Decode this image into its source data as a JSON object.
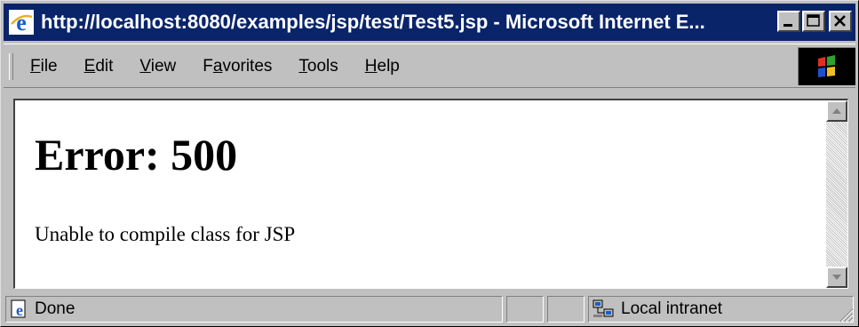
{
  "window": {
    "title": "http://localhost:8080/examples/jsp/test/Test5.jsp - Microsoft Internet E...",
    "icon": "ie-logo-icon",
    "controls": [
      "minimize-icon",
      "maximize-icon",
      "close-icon"
    ]
  },
  "menubar": {
    "items": [
      {
        "label": "File",
        "accel": "F"
      },
      {
        "label": "Edit",
        "accel": "E"
      },
      {
        "label": "View",
        "accel": "V"
      },
      {
        "label": "Favorites",
        "accel": "a"
      },
      {
        "label": "Tools",
        "accel": "T"
      },
      {
        "label": "Help",
        "accel": "H"
      }
    ],
    "throbber_icon": "windows-flag-icon"
  },
  "page": {
    "heading": "Error: 500",
    "message": "Unable to compile class for JSP"
  },
  "statusbar": {
    "status": "Done",
    "status_icon": "ie-page-icon",
    "zone": "Local intranet",
    "zone_icon": "network-computers-icon"
  },
  "colors": {
    "titlebar": "#0a246a",
    "chrome": "#c0c0c0",
    "content_bg": "#ffffff"
  }
}
